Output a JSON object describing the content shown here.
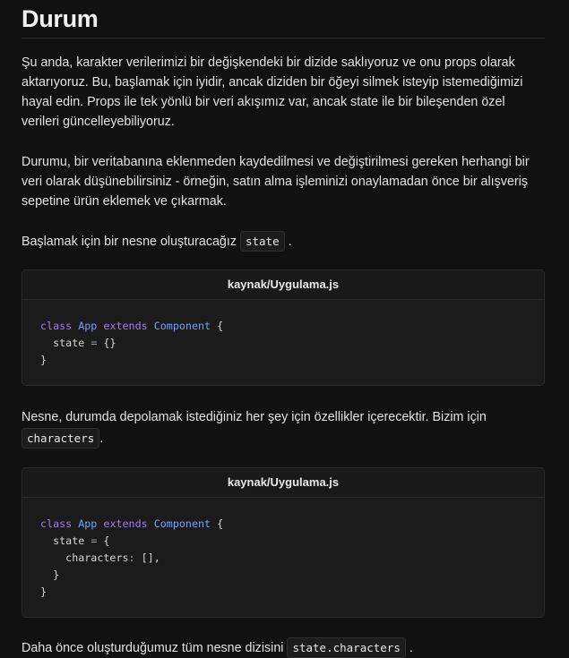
{
  "heading": "Durum",
  "paragraphs": {
    "p1": "Şu anda, karakter verilerimizi bir değişkendeki bir dizide saklıyoruz ve onu props olarak aktarıyoruz. Bu, başlamak için iyidir, ancak diziden bir öğeyi silmek isteyip istemediğimizi hayal edin. Props ile tek yönlü bir veri akışımız var, ancak state ile bir bileşenden özel verileri güncelleyebiliyoruz.",
    "p2": "Durumu, bir veritabanına eklenmeden kaydedilmesi ve değiştirilmesi gereken herhangi bir veri olarak düşünebilirsiniz - örneğin, satın alma işleminizi onaylamadan önce bir alışveriş sepetine ürün eklemek ve çıkarmak.",
    "p3_text": "Başlamak için bir nesne oluşturacağız",
    "p3_code": "state",
    "p3_end": ".",
    "p4_text": "Nesne, durumda depolamak istediğiniz her şey için özellikler içerecektir. Bizim için",
    "p4_code": "characters",
    "p4_end": ".",
    "p5_text": "Daha önce oluşturduğumuz tüm nesne dizisini",
    "p5_code": "state.characters",
    "p5_end": "."
  },
  "code_block_1": {
    "filename": "kaynak/Uygulama.js",
    "kw_class": "class",
    "name": "App",
    "kw_extends": "extends",
    "parent": "Component",
    "open": "{",
    "line2_prop": "state",
    "line2_eq": "=",
    "line2_val": "{}",
    "close": "}"
  },
  "code_block_2": {
    "filename": "kaynak/Uygulama.js",
    "kw_class": "class",
    "name": "App",
    "kw_extends": "extends",
    "parent": "Component",
    "open": "{",
    "line2_prop": "state",
    "line2_eq": "=",
    "line2_open": "{",
    "line3_prop": "characters",
    "line3_colon": ":",
    "line3_val": "[],",
    "line4_close": "}",
    "close": "}"
  }
}
